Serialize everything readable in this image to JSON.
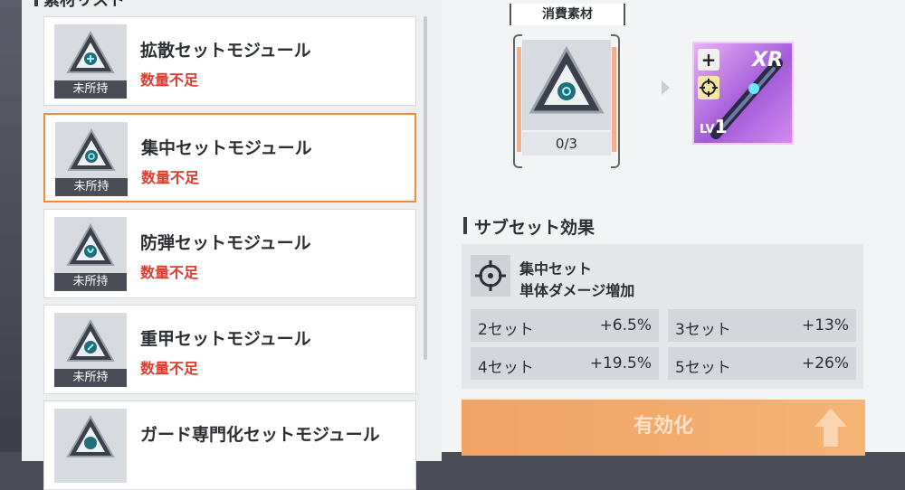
{
  "left": {
    "section_title": "素材リスト",
    "items": [
      {
        "name": "拡散セットモジュール",
        "status": "数量不足",
        "owned": "未所持",
        "selected": false,
        "glyph": "spread-glyph"
      },
      {
        "name": "集中セットモジュール",
        "status": "数量不足",
        "owned": "未所持",
        "selected": true,
        "glyph": "crosshair-glyph"
      },
      {
        "name": "防弾セットモジュール",
        "status": "数量不足",
        "owned": "未所持",
        "selected": false,
        "glyph": "shield-glyph"
      },
      {
        "name": "重甲セットモジュール",
        "status": "数量不足",
        "owned": "未所持",
        "selected": false,
        "glyph": "armor-glyph"
      },
      {
        "name": "ガード専門化セットモジュール",
        "status": "",
        "owned": "",
        "selected": false,
        "glyph": "guard-glyph"
      }
    ]
  },
  "right": {
    "consume_label": "消費素材",
    "slot_count": "0/3",
    "equip": {
      "rarity": "XR",
      "level_prefix": "LV",
      "level": "1",
      "plus_icon": "plus-icon",
      "target_icon": "crosshair-icon"
    },
    "subset": {
      "title": "サブセット効果",
      "name": "集中セット",
      "desc": "単体ダメージ増加",
      "bonuses": [
        {
          "label": "2セット",
          "value": "+6.5%"
        },
        {
          "label": "3セット",
          "value": "+13%"
        },
        {
          "label": "4セット",
          "value": "+19.5%"
        },
        {
          "label": "5セット",
          "value": "+26%"
        }
      ]
    },
    "activate_label": "有効化"
  },
  "colors": {
    "accent": "#f08a3c",
    "warning": "#e03c2e",
    "rarity_purple": "#a25bd8"
  }
}
